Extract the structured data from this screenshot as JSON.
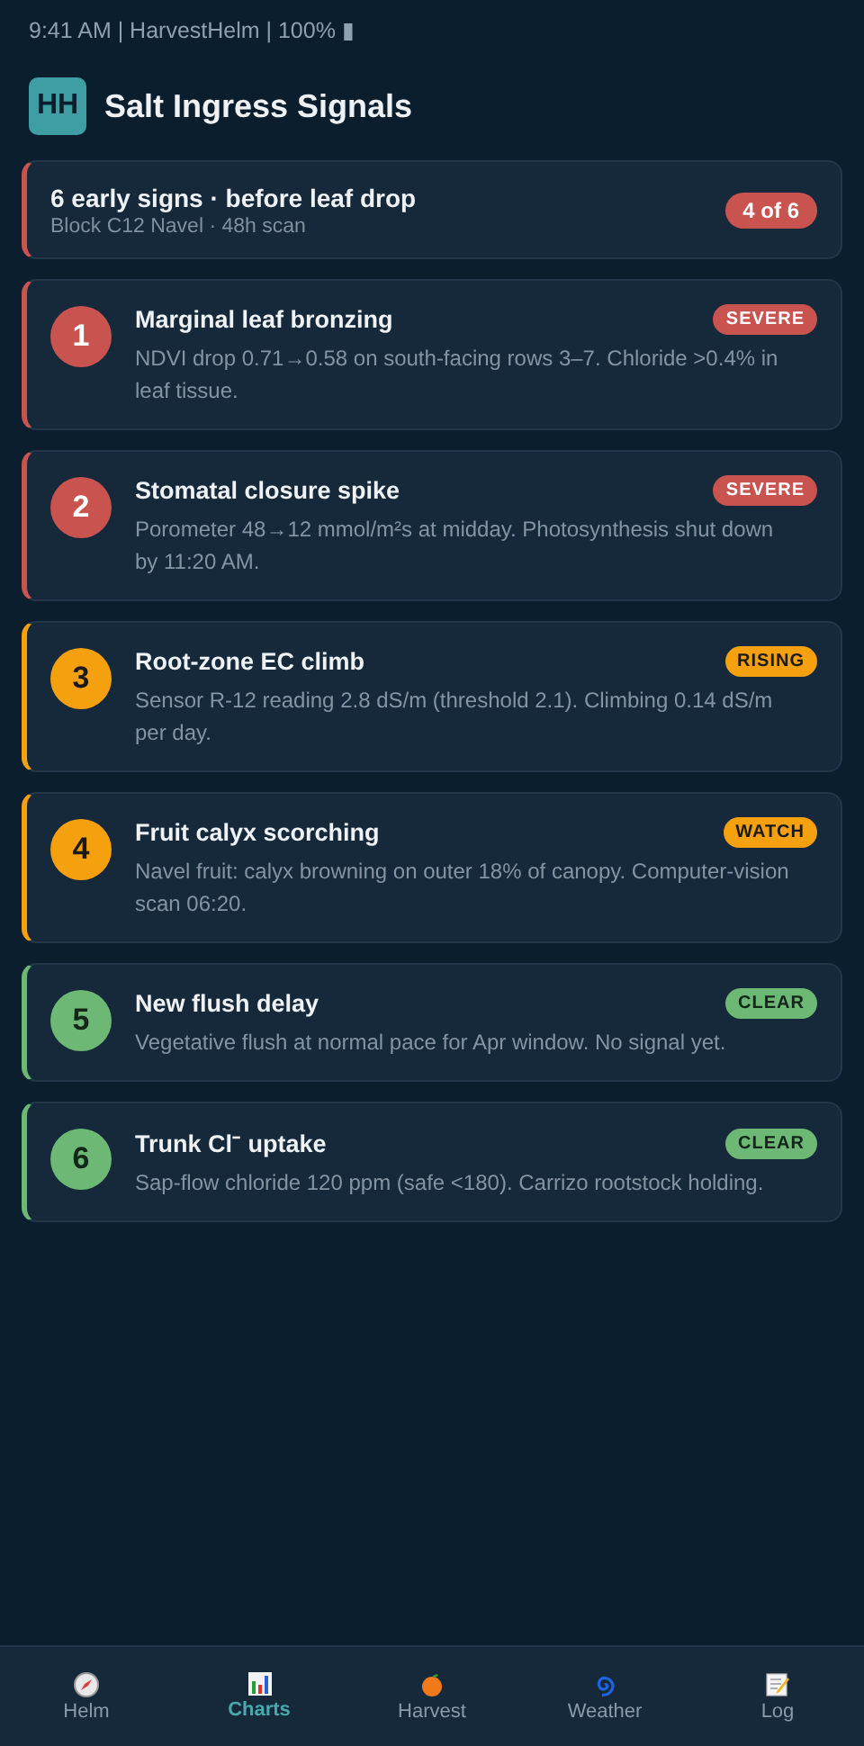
{
  "status_bar": {
    "text": "9:41 AM | HarvestHelm | 100% ▮"
  },
  "header": {
    "logo": "HH",
    "title": "Salt Ingress Signals"
  },
  "summary": {
    "title": "6 early signs · before leaf drop",
    "subtitle": "Block C12 Navel · 48h scan",
    "badge": "4 of 6",
    "kind": "severe"
  },
  "signals": [
    {
      "number": "1",
      "title": "Marginal leaf bronzing",
      "detail": "NDVI drop 0.71→0.58 on south-facing rows 3–7. Chloride >0.4% in leaf tissue.",
      "badge": "SEVERE",
      "kind": "severe"
    },
    {
      "number": "2",
      "title": "Stomatal closure spike",
      "detail": "Porometer 48→12 mmol/m²s at midday. Photosynthesis shut down by 11:20 AM.",
      "badge": "SEVERE",
      "kind": "severe"
    },
    {
      "number": "3",
      "title": "Root-zone EC climb",
      "detail": "Sensor R-12 reading 2.8 dS/m (threshold 2.1). Climbing 0.14 dS/m per day.",
      "badge": "RISING",
      "kind": "rising"
    },
    {
      "number": "4",
      "title": "Fruit calyx scorching",
      "detail": "Navel fruit: calyx browning on outer 18% of canopy. Computer-vision scan 06:20.",
      "badge": "WATCH",
      "kind": "watch"
    },
    {
      "number": "5",
      "title": "New flush delay",
      "detail": "Vegetative flush at normal pace for Apr window. No signal yet.",
      "badge": "CLEAR",
      "kind": "clear"
    },
    {
      "number": "6",
      "title": "Trunk Cl⁻ uptake",
      "detail": "Sap-flow chloride 120 ppm (safe <180). Carrizo rootstock holding.",
      "badge": "CLEAR",
      "kind": "clear"
    }
  ],
  "nav": [
    {
      "label": "Helm",
      "selected": false
    },
    {
      "label": "Charts",
      "selected": true
    },
    {
      "label": "Harvest",
      "selected": false
    },
    {
      "label": "Weather",
      "selected": false
    },
    {
      "label": "Log",
      "selected": false
    }
  ]
}
